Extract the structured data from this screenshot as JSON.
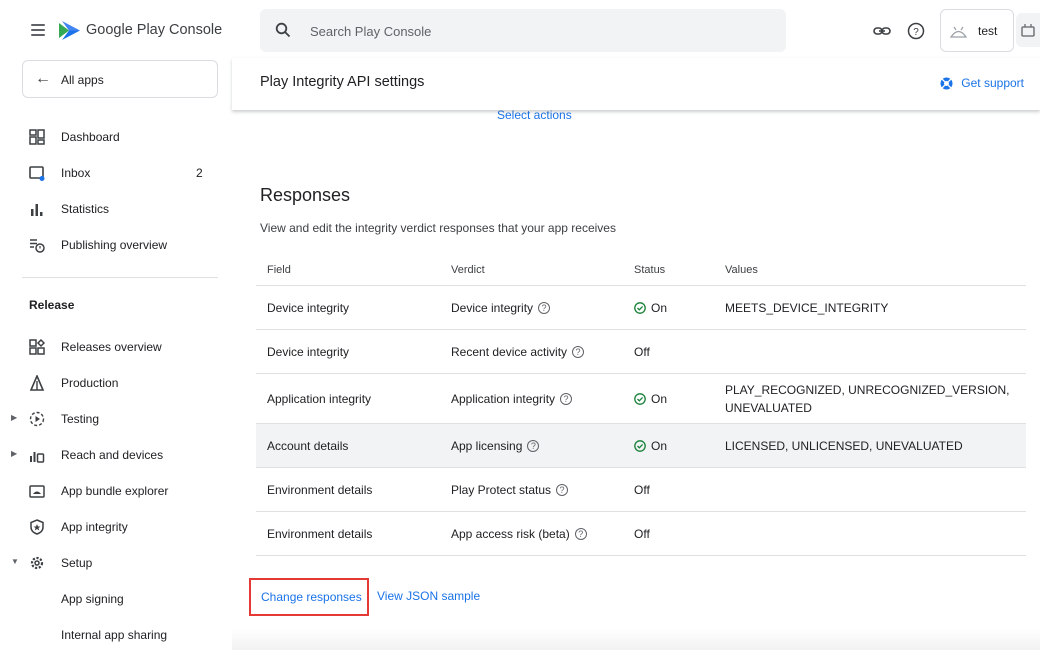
{
  "header": {
    "brand": "Google Play Console",
    "search_placeholder": "Search Play Console",
    "account_name": "test"
  },
  "sidebar": {
    "all_apps": "All apps",
    "items": [
      {
        "label": "Dashboard",
        "icon": "dashboard-icon"
      },
      {
        "label": "Inbox",
        "icon": "inbox-icon",
        "count": "2"
      },
      {
        "label": "Statistics",
        "icon": "statistics-icon"
      },
      {
        "label": "Publishing overview",
        "icon": "publishing-overview-icon"
      }
    ],
    "section": "Release",
    "release_items": [
      {
        "label": "Releases overview",
        "icon": "releases-overview-icon"
      },
      {
        "label": "Production",
        "icon": "production-icon"
      },
      {
        "label": "Testing",
        "icon": "testing-icon"
      },
      {
        "label": "Reach and devices",
        "icon": "reach-devices-icon"
      },
      {
        "label": "App bundle explorer",
        "icon": "bundle-explorer-icon"
      },
      {
        "label": "App integrity",
        "icon": "app-integrity-icon"
      },
      {
        "label": "Setup",
        "icon": "setup-gear-icon"
      },
      {
        "label": "App signing"
      },
      {
        "label": "Internal app sharing"
      }
    ]
  },
  "page": {
    "title": "Play Integrity API settings",
    "support": "Get support",
    "select_actions": "Select actions"
  },
  "responses": {
    "title": "Responses",
    "description": "View and edit the integrity verdict responses that your app receives",
    "columns": [
      "Field",
      "Verdict",
      "Status",
      "Values"
    ],
    "rows": [
      {
        "field": "Device integrity",
        "verdict": "Device integrity",
        "status": "On",
        "values": "MEETS_DEVICE_INTEGRITY"
      },
      {
        "field": "Device integrity",
        "verdict": "Recent device activity",
        "status": "Off",
        "values": ""
      },
      {
        "field": "Application integrity",
        "verdict": "Application integrity",
        "status": "On",
        "values_line1": "PLAY_RECOGNIZED, UNRECOGNIZED_VERSION,",
        "values_line2": "UNEVALUATED"
      },
      {
        "field": "Account details",
        "verdict": "App licensing",
        "status": "On",
        "values": "LICENSED, UNLICENSED, UNEVALUATED"
      },
      {
        "field": "Environment details",
        "verdict": "Play Protect status",
        "status": "Off",
        "values": ""
      },
      {
        "field": "Environment details",
        "verdict": "App access risk (beta)",
        "status": "Off",
        "values": ""
      }
    ],
    "change_button": "Change responses",
    "json_link": "View JSON sample"
  },
  "colors": {
    "accent": "#1a73e8",
    "status_on": "#188038",
    "highlight_border": "#e53935"
  }
}
